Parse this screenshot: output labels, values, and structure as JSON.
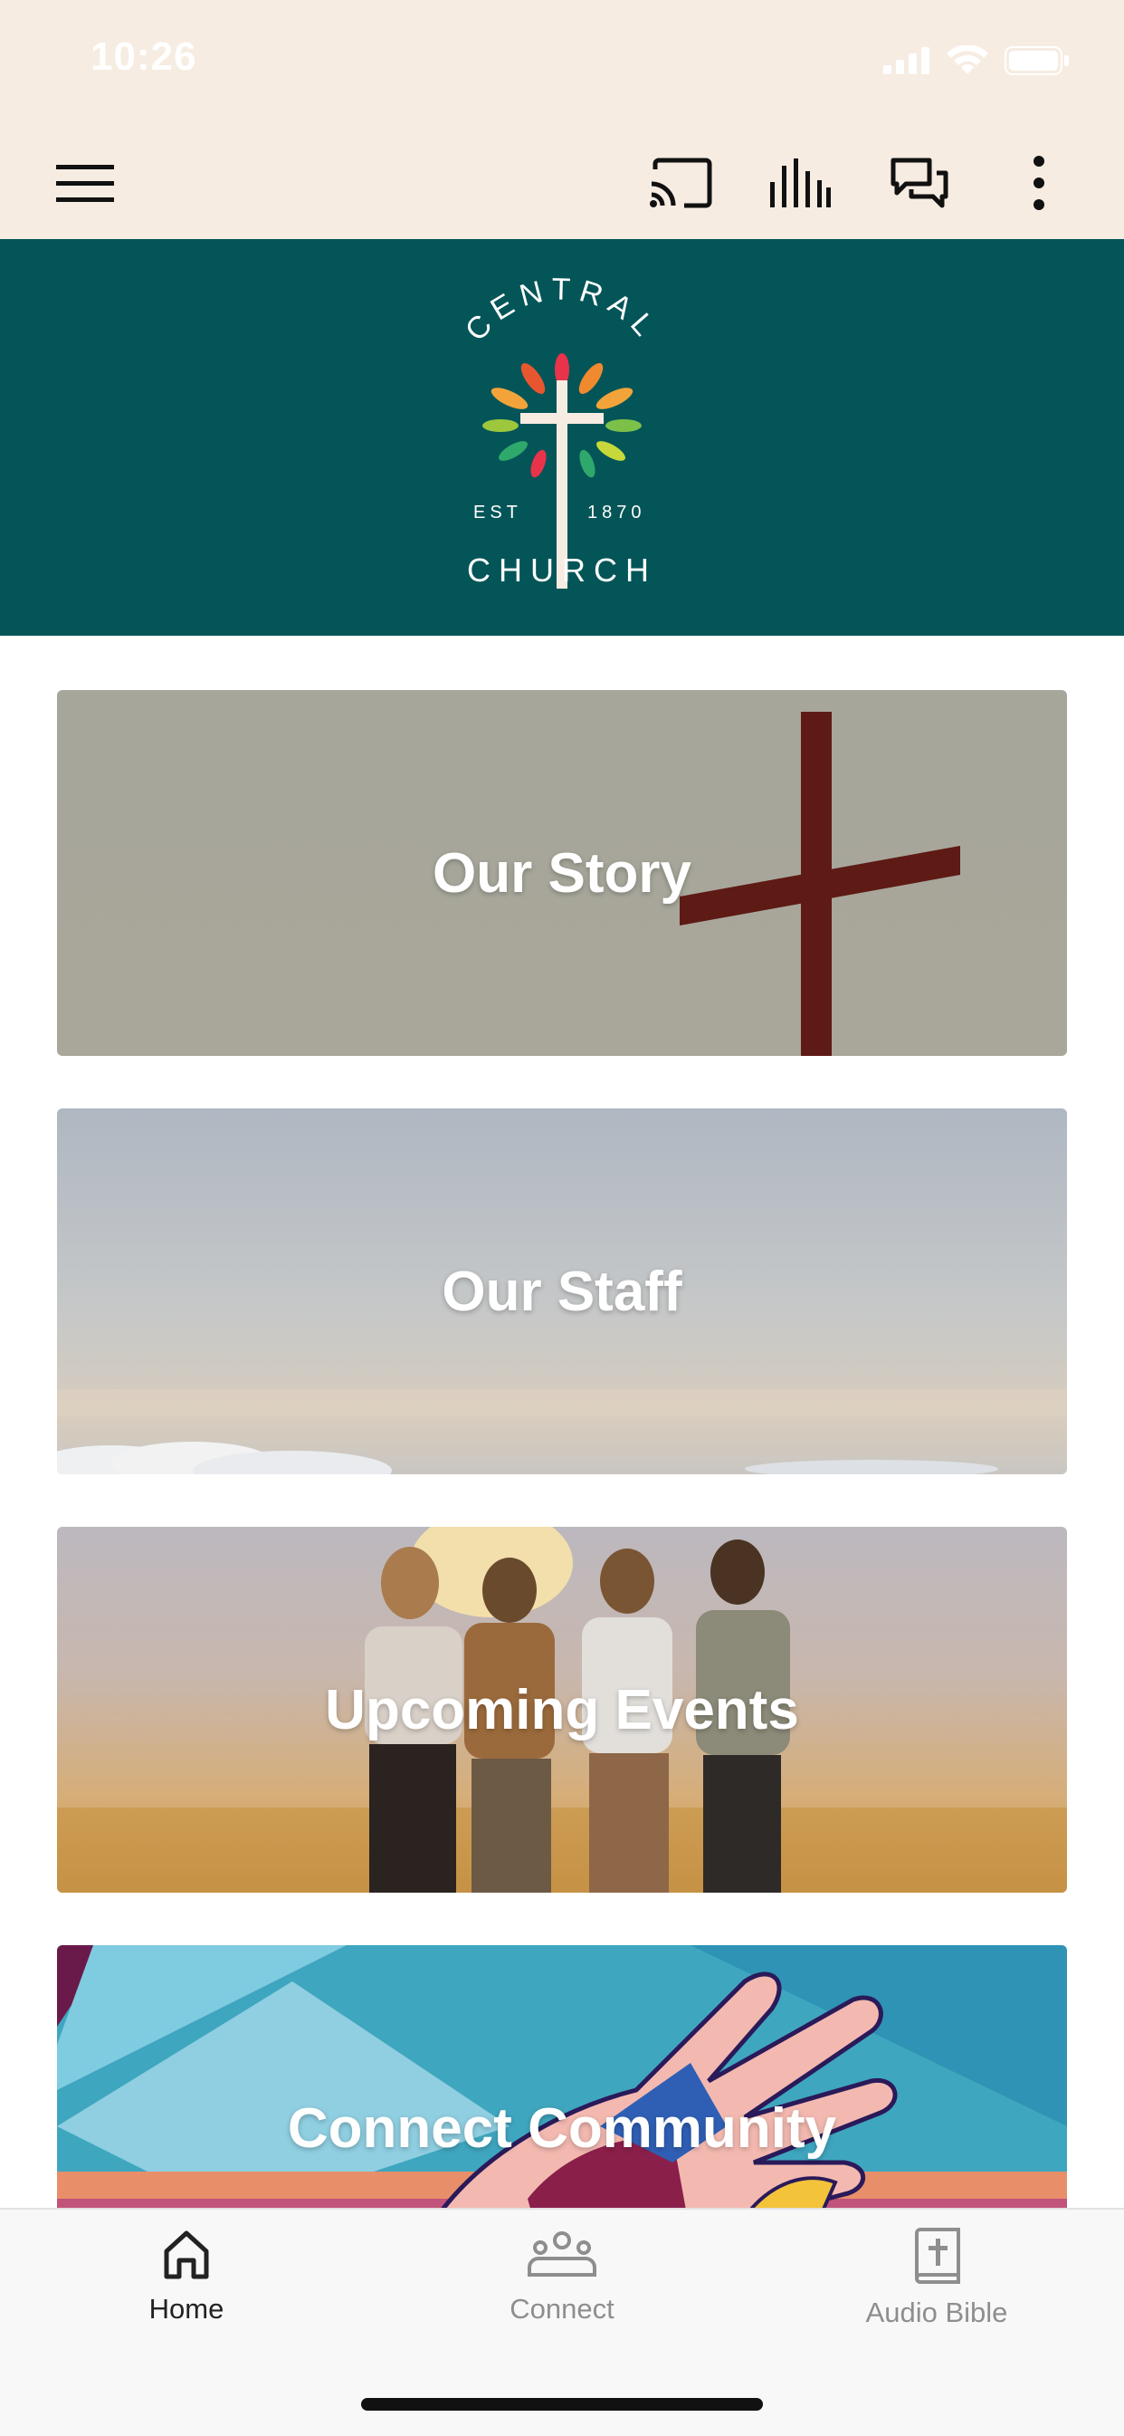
{
  "status_bar": {
    "time": "10:26"
  },
  "app_bar": {
    "icons": [
      "menu-icon",
      "cast-icon",
      "audio-bars-icon",
      "chat-icon",
      "more-vert-icon"
    ],
    "background": "#f6ece2"
  },
  "banner": {
    "background": "#045558",
    "logo_top_text": "CENTRAL",
    "logo_est": "EST",
    "logo_year": "1870",
    "logo_bottom_text": "CHURCH"
  },
  "tiles": [
    {
      "label": "Our Story"
    },
    {
      "label": "Our Staff"
    },
    {
      "label": "Upcoming Events"
    },
    {
      "label": "Connect Community"
    }
  ],
  "bottom_nav": {
    "items": [
      {
        "label": "Home",
        "icon": "home-icon",
        "active": true
      },
      {
        "label": "Connect",
        "icon": "group-icon",
        "active": false
      },
      {
        "label": "Audio Bible",
        "icon": "bible-icon",
        "active": false
      }
    ],
    "active_color": "#222222",
    "inactive_color": "#8e8e8e"
  }
}
